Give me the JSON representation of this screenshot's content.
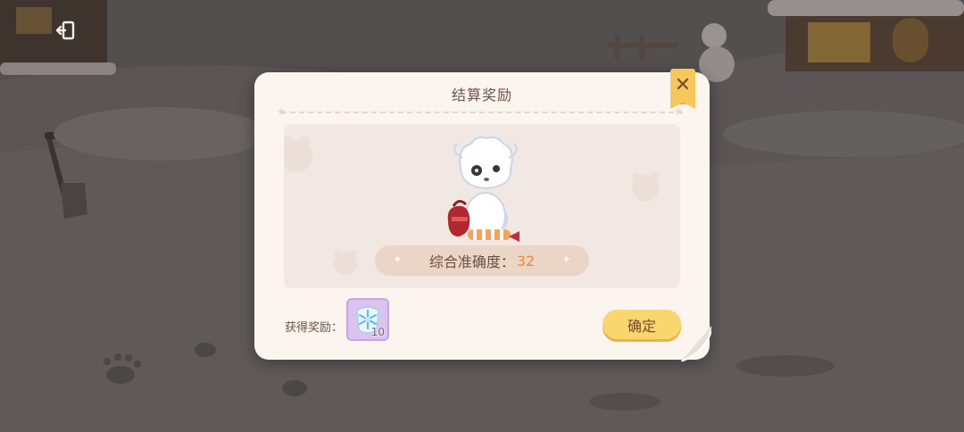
{
  "dialog": {
    "title": "结算奖励",
    "close_icon": "close-icon",
    "score_label": "综合准确度：",
    "score_value": "32",
    "reward_label": "获得奖励：",
    "reward_item": {
      "icon": "snowflake-icon",
      "count": "10"
    },
    "confirm_label": "确定"
  },
  "hud": {
    "exit_icon": "exit-door-icon"
  },
  "colors": {
    "dialog_bg": "#fbf4ef",
    "accent_yellow": "#f6c75b",
    "score_orange": "#ee8a3a",
    "reward_purple": "#dcc3ef"
  }
}
